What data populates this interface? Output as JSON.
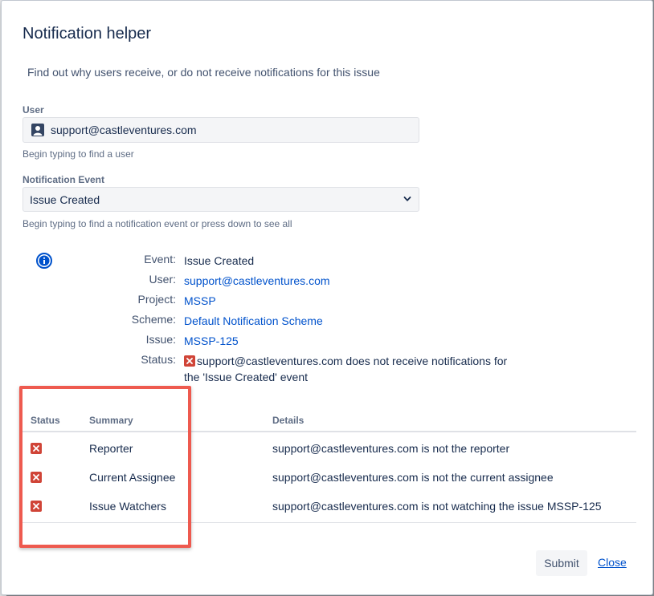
{
  "dialog": {
    "title": "Notification helper",
    "intro": "Find out why users receive, or do not receive notifications for this issue"
  },
  "form": {
    "user_label": "User",
    "user_value": "support@castleventures.com",
    "user_help": "Begin typing to find a user",
    "event_label": "Notification Event",
    "event_value": "Issue Created",
    "event_help": "Begin typing to find a notification event or press down to see all"
  },
  "info": {
    "rows": [
      {
        "key": "Event:",
        "value": "Issue Created"
      },
      {
        "key": "User:",
        "value": "support@castleventures.com"
      },
      {
        "key": "Project:",
        "value": "MSSP"
      },
      {
        "key": "Scheme:",
        "value": "Default Notification Scheme"
      },
      {
        "key": "Issue:",
        "value": "MSSP-125"
      },
      {
        "key": "Status:",
        "value": "support@castleventures.com does not receive notifications for the 'Issue Created' event"
      }
    ]
  },
  "table": {
    "headers": [
      "Status",
      "Summary",
      "Details"
    ],
    "rows": [
      {
        "summary": "Reporter",
        "details": "support@castleventures.com is not the reporter"
      },
      {
        "summary": "Current Assignee",
        "details": "support@castleventures.com is not the current assignee"
      },
      {
        "summary": "Issue Watchers",
        "details": "support@castleventures.com is not watching the issue MSSP-125"
      }
    ]
  },
  "actions": {
    "submit_label": "Submit",
    "close_label": "Close"
  },
  "colors": {
    "link": "#0052cc",
    "error": "#d04437",
    "highlight": "#ee5a4f"
  }
}
